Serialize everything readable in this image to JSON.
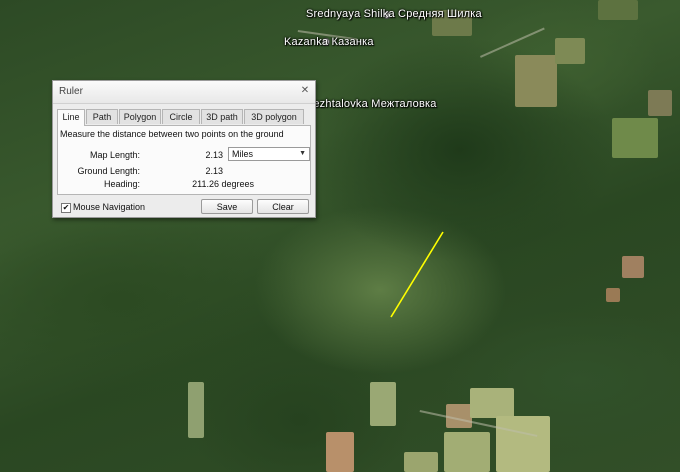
{
  "map": {
    "places": [
      {
        "name": "Srednyaya Shilka Средняя Шилка"
      },
      {
        "name": "Kazanka Казанка"
      },
      {
        "name": "Mezhtalovka Межталовка"
      }
    ],
    "measure_line_color": "#ffff00"
  },
  "ruler": {
    "title": "Ruler",
    "tabs": [
      "Line",
      "Path",
      "Polygon",
      "Circle",
      "3D path",
      "3D polygon"
    ],
    "active_tab": "Line",
    "description": "Measure the distance between two points on the ground",
    "map_length_label": "Map Length:",
    "map_length_value": "2.13",
    "unit": "Miles",
    "ground_length_label": "Ground Length:",
    "ground_length_value": "2.13",
    "heading_label": "Heading:",
    "heading_value": "211.26 degrees",
    "mouse_navigation_label": "Mouse Navigation",
    "mouse_navigation_checked": true,
    "save_label": "Save",
    "clear_label": "Clear"
  }
}
